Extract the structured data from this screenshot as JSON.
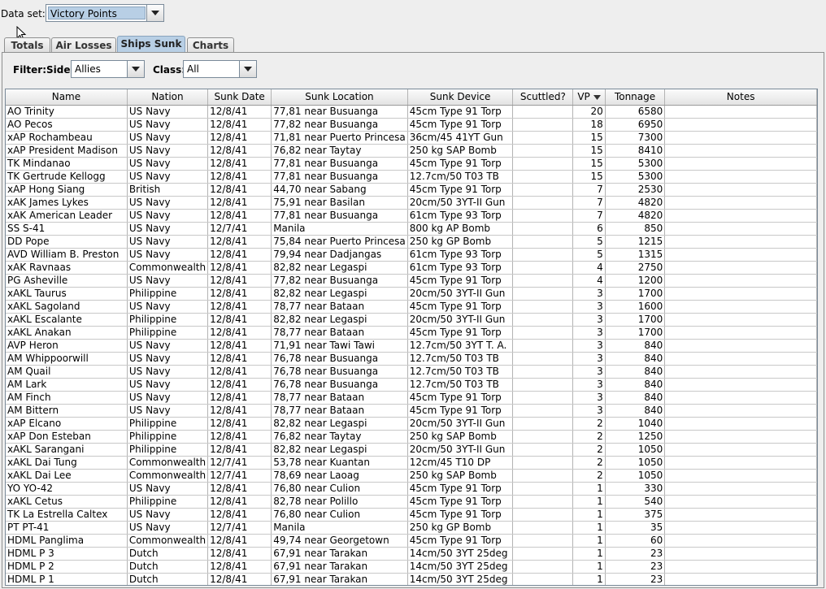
{
  "dataset": {
    "label": "Data set:",
    "value": "Victory Points"
  },
  "tabs": [
    {
      "label": "Totals",
      "active": false
    },
    {
      "label": "Air Losses",
      "active": false
    },
    {
      "label": "Ships Sunk",
      "active": true
    },
    {
      "label": "Charts",
      "active": false
    }
  ],
  "filter": {
    "label": "Filter:",
    "side_label": "Side:",
    "side_value": "Allies",
    "class_label": "Class:",
    "class_value": "All"
  },
  "table": {
    "columns": [
      "Name",
      "Nation",
      "Sunk Date",
      "Sunk Location",
      "Sunk Device",
      "Scuttled?",
      "VP",
      "Tonnage",
      "Notes"
    ],
    "sort_column": "VP",
    "rows": [
      [
        "AO Trinity",
        "US Navy",
        "12/8/41",
        "77,81 near Busuanga",
        "45cm Type 91 Torp",
        "",
        "20",
        "6580",
        ""
      ],
      [
        "AO Pecos",
        "US Navy",
        "12/8/41",
        "77,82 near Busuanga",
        "45cm Type 91 Torp",
        "",
        "18",
        "6950",
        ""
      ],
      [
        "xAP Rochambeau",
        "US Navy",
        "12/8/41",
        "71,81 near Puerto Princesa",
        "36cm/45 41YT Gun",
        "",
        "15",
        "7300",
        ""
      ],
      [
        "xAP President Madison",
        "US Navy",
        "12/8/41",
        "76,82 near Taytay",
        "250 kg SAP Bomb",
        "",
        "15",
        "8410",
        ""
      ],
      [
        "TK Mindanao",
        "US Navy",
        "12/8/41",
        "77,81 near Busuanga",
        "45cm Type 91 Torp",
        "",
        "15",
        "5300",
        ""
      ],
      [
        "TK Gertrude Kellogg",
        "US Navy",
        "12/8/41",
        "77,81 near Busuanga",
        "12.7cm/50 T03 TB",
        "",
        "15",
        "5300",
        ""
      ],
      [
        "xAP Hong Siang",
        "British",
        "12/8/41",
        "44,70 near Sabang",
        "45cm Type 91 Torp",
        "",
        "7",
        "2530",
        ""
      ],
      [
        "xAK James Lykes",
        "US Navy",
        "12/8/41",
        "75,91 near Basilan",
        "20cm/50 3YT-II Gun",
        "",
        "7",
        "4820",
        ""
      ],
      [
        "xAK American Leader",
        "US Navy",
        "12/8/41",
        "77,81 near Busuanga",
        "61cm Type 93 Torp",
        "",
        "7",
        "4820",
        ""
      ],
      [
        "SS S-41",
        "US Navy",
        "12/7/41",
        "Manila",
        "800 kg AP Bomb",
        "",
        "6",
        "850",
        ""
      ],
      [
        "DD Pope",
        "US Navy",
        "12/8/41",
        "75,84 near Puerto Princesa",
        "250 kg GP Bomb",
        "",
        "5",
        "1215",
        ""
      ],
      [
        "AVD William B. Preston",
        "US Navy",
        "12/8/41",
        "79,94 near Dadjangas",
        "61cm Type 93 Torp",
        "",
        "5",
        "1315",
        ""
      ],
      [
        "xAK Ravnaas",
        "Commonwealth",
        "12/8/41",
        "82,82 near Legaspi",
        "61cm Type 93 Torp",
        "",
        "4",
        "2750",
        ""
      ],
      [
        "PG Asheville",
        "US Navy",
        "12/8/41",
        "77,82 near Busuanga",
        "45cm Type 91 Torp",
        "",
        "4",
        "1200",
        ""
      ],
      [
        "xAKL Taurus",
        "Philippine",
        "12/8/41",
        "82,82 near Legaspi",
        "20cm/50 3YT-II Gun",
        "",
        "3",
        "1700",
        ""
      ],
      [
        "xAKL Sagoland",
        "US Navy",
        "12/8/41",
        "78,77 near Bataan",
        "45cm Type 91 Torp",
        "",
        "3",
        "1600",
        ""
      ],
      [
        "xAKL Escalante",
        "Philippine",
        "12/8/41",
        "82,82 near Legaspi",
        "20cm/50 3YT-II Gun",
        "",
        "3",
        "1700",
        ""
      ],
      [
        "xAKL Anakan",
        "Philippine",
        "12/8/41",
        "78,77 near Bataan",
        "45cm Type 91 Torp",
        "",
        "3",
        "1700",
        ""
      ],
      [
        "AVP Heron",
        "US Navy",
        "12/8/41",
        "71,91 near Tawi Tawi",
        "12.7cm/50 3YT T. A.",
        "",
        "3",
        "840",
        ""
      ],
      [
        "AM Whippoorwill",
        "US Navy",
        "12/8/41",
        "76,78 near Busuanga",
        "12.7cm/50 T03 TB",
        "",
        "3",
        "840",
        ""
      ],
      [
        "AM Quail",
        "US Navy",
        "12/8/41",
        "76,78 near Busuanga",
        "12.7cm/50 T03 TB",
        "",
        "3",
        "840",
        ""
      ],
      [
        "AM Lark",
        "US Navy",
        "12/8/41",
        "76,78 near Busuanga",
        "12.7cm/50 T03 TB",
        "",
        "3",
        "840",
        ""
      ],
      [
        "AM Finch",
        "US Navy",
        "12/8/41",
        "78,77 near Bataan",
        "45cm Type 91 Torp",
        "",
        "3",
        "840",
        ""
      ],
      [
        "AM Bittern",
        "US Navy",
        "12/8/41",
        "78,77 near Bataan",
        "45cm Type 91 Torp",
        "",
        "3",
        "840",
        ""
      ],
      [
        "xAP Elcano",
        "Philippine",
        "12/8/41",
        "82,82 near Legaspi",
        "20cm/50 3YT-II Gun",
        "",
        "2",
        "1040",
        ""
      ],
      [
        "xAP Don Esteban",
        "Philippine",
        "12/8/41",
        "76,82 near Taytay",
        "250 kg SAP Bomb",
        "",
        "2",
        "1250",
        ""
      ],
      [
        "xAKL Sarangani",
        "Philippine",
        "12/8/41",
        "82,82 near Legaspi",
        "20cm/50 3YT-II Gun",
        "",
        "2",
        "1050",
        ""
      ],
      [
        "xAKL Dai Tung",
        "Commonwealth",
        "12/7/41",
        "53,78 near Kuantan",
        "12cm/45 T10 DP",
        "",
        "2",
        "1050",
        ""
      ],
      [
        "xAKL Dai Lee",
        "Commonwealth",
        "12/7/41",
        "78,69 near Laoag",
        "250 kg SAP Bomb",
        "",
        "2",
        "1050",
        ""
      ],
      [
        "YO YO-42",
        "US Navy",
        "12/8/41",
        "76,80 near Culion",
        "45cm Type 91 Torp",
        "",
        "1",
        "330",
        ""
      ],
      [
        "xAKL Cetus",
        "Philippine",
        "12/8/41",
        "82,78 near Polillo",
        "45cm Type 91 Torp",
        "",
        "1",
        "540",
        ""
      ],
      [
        "TK La Estrella Caltex",
        "US Navy",
        "12/8/41",
        "76,80 near Culion",
        "45cm Type 91 Torp",
        "",
        "1",
        "375",
        ""
      ],
      [
        "PT PT-41",
        "US Navy",
        "12/7/41",
        "Manila",
        "250 kg GP Bomb",
        "",
        "1",
        "35",
        ""
      ],
      [
        "HDML Panglima",
        "Commonwealth",
        "12/8/41",
        "49,74 near Georgetown",
        "45cm Type 91 Torp",
        "",
        "1",
        "60",
        ""
      ],
      [
        "HDML P 3",
        "Dutch",
        "12/8/41",
        "67,91 near Tarakan",
        "14cm/50 3YT 25deg",
        "",
        "1",
        "23",
        ""
      ],
      [
        "HDML P 2",
        "Dutch",
        "12/8/41",
        "67,91 near Tarakan",
        "14cm/50 3YT 25deg",
        "",
        "1",
        "23",
        ""
      ],
      [
        "HDML P 1",
        "Dutch",
        "12/8/41",
        "67,91 near Tarakan",
        "14cm/50 3YT 25deg",
        "",
        "1",
        "23",
        ""
      ]
    ]
  }
}
